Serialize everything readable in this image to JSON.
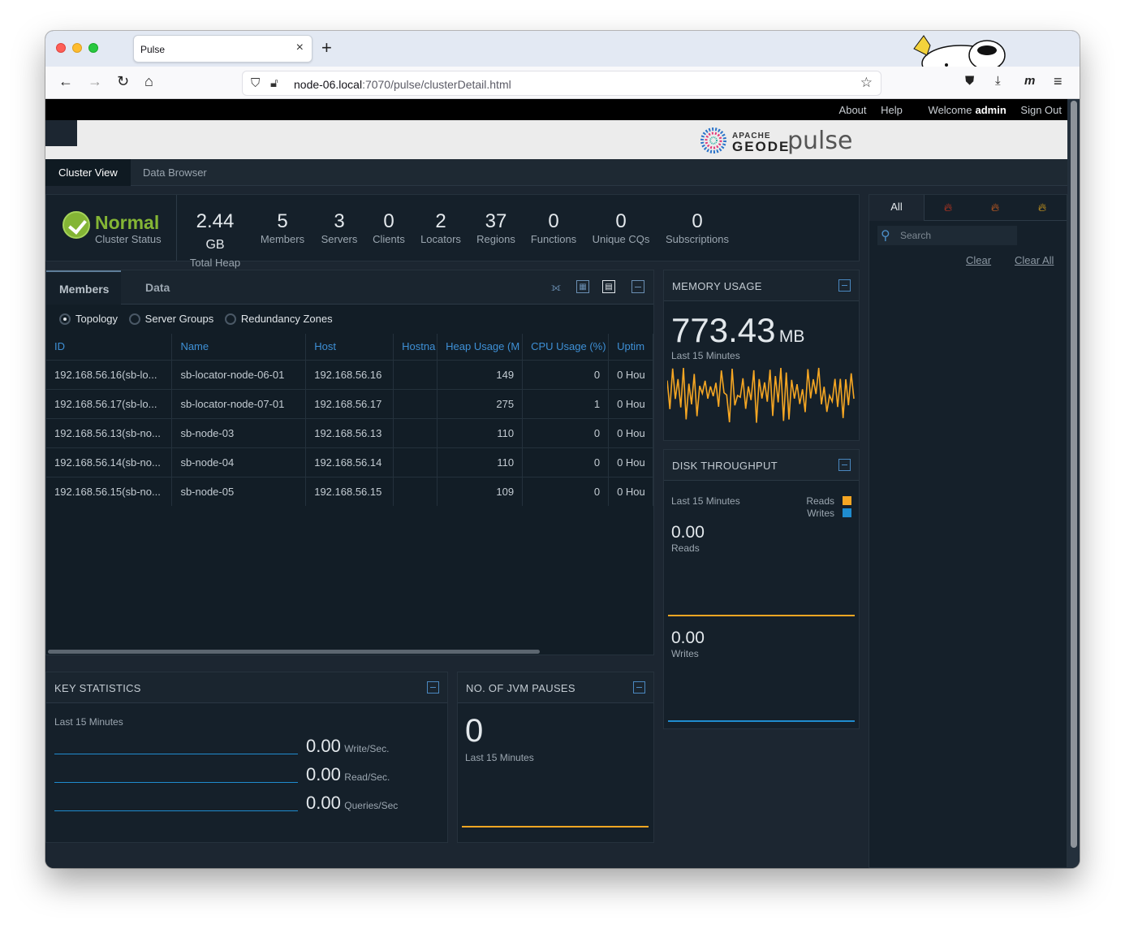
{
  "browser": {
    "tab_title": "Pulse",
    "url_host": "node-06.local",
    "url_path": ":7070/pulse/clusterDetail.html"
  },
  "topbar": {
    "about": "About",
    "help": "Help",
    "welcome": "Welcome",
    "user": "admin",
    "sign_out": "Sign Out"
  },
  "logo": {
    "apache": "APACHE",
    "geode": "GEODE",
    "pulse": "pulse"
  },
  "app_tabs": {
    "cluster_view": "Cluster View",
    "data_browser": "Data Browser"
  },
  "cluster": {
    "status": "Normal",
    "status_label": "Cluster Status",
    "stats": [
      {
        "value": "2.44",
        "unit": "GB",
        "label": "Total Heap"
      },
      {
        "value": "5",
        "label": "Members"
      },
      {
        "value": "3",
        "label": "Servers"
      },
      {
        "value": "0",
        "label": "Clients"
      },
      {
        "value": "2",
        "label": "Locators"
      },
      {
        "value": "37",
        "label": "Regions"
      },
      {
        "value": "0",
        "label": "Functions"
      },
      {
        "value": "0",
        "label": "Unique CQs"
      },
      {
        "value": "0",
        "label": "Subscriptions"
      }
    ]
  },
  "alerts": {
    "tab_all": "All",
    "search_placeholder": "Search",
    "clear": "Clear",
    "clear_all": "Clear All",
    "icons": [
      "flame-red-icon",
      "flame-orange-icon",
      "flame-yellow-icon"
    ],
    "colors": {
      "red": "#e03a1e",
      "orange": "#ef6b1f",
      "yellow": "#f5b31a"
    }
  },
  "members": {
    "tabs": {
      "members": "Members",
      "data": "Data"
    },
    "view_options": [
      "Topology",
      "Server Groups",
      "Redundancy Zones"
    ],
    "selected_view": "Topology",
    "columns": [
      "ID",
      "Name",
      "Host",
      "Hostna",
      "Heap Usage (M",
      "CPU Usage (%)",
      "Uptim"
    ],
    "rows": [
      [
        "192.168.56.16(sb-lo...",
        "sb-locator-node-06-01",
        "192.168.56.16",
        "",
        "149",
        "0",
        "0 Hou"
      ],
      [
        "192.168.56.17(sb-lo...",
        "sb-locator-node-07-01",
        "192.168.56.17",
        "",
        "275",
        "1",
        "0 Hou"
      ],
      [
        "192.168.56.13(sb-no...",
        "sb-node-03",
        "192.168.56.13",
        "",
        "110",
        "0",
        "0 Hou"
      ],
      [
        "192.168.56.14(sb-no...",
        "sb-node-04",
        "192.168.56.14",
        "",
        "110",
        "0",
        "0 Hou"
      ],
      [
        "192.168.56.15(sb-no...",
        "sb-node-05",
        "192.168.56.15",
        "",
        "109",
        "0",
        "0 Hou"
      ]
    ]
  },
  "memory": {
    "title": "MEMORY USAGE",
    "value": "773.43",
    "unit": "MB",
    "period": "Last 15 Minutes",
    "line_color": "#f5a623"
  },
  "disk": {
    "title": "DISK THROUGHPUT",
    "period": "Last 15 Minutes",
    "legend_reads": "Reads",
    "legend_writes": "Writes",
    "reads_color": "#f5a623",
    "writes_color": "#1f8ccf",
    "reads_value": "0.00",
    "reads_label": "Reads",
    "writes_value": "0.00",
    "writes_label": "Writes"
  },
  "key_stats": {
    "title": "KEY STATISTICS",
    "period": "Last 15 Minutes",
    "rows": [
      {
        "value": "0.00",
        "label": "Write/Sec."
      },
      {
        "value": "0.00",
        "label": "Read/Sec."
      },
      {
        "value": "0.00",
        "label": "Queries/Sec"
      }
    ]
  },
  "jvm": {
    "title": "NO. OF JVM PAUSES",
    "value": "0",
    "period": "Last 15 Minutes"
  }
}
